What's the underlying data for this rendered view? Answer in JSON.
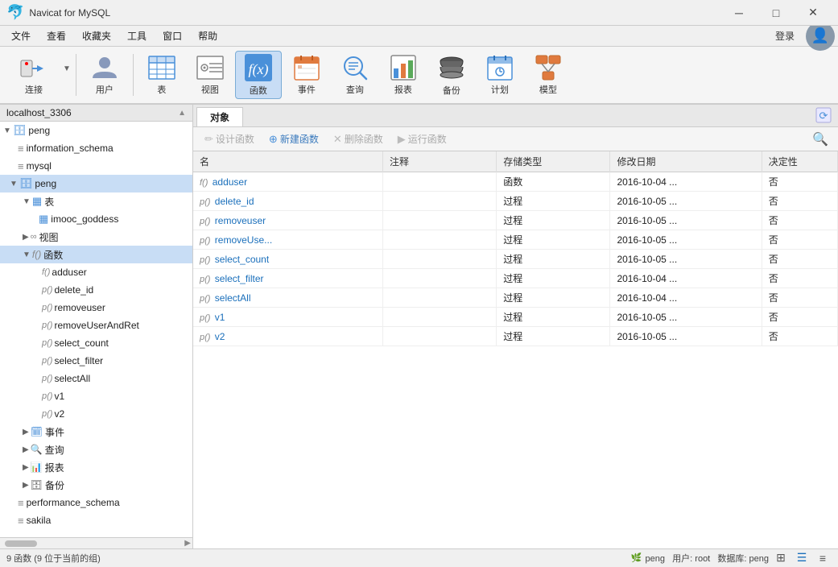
{
  "app": {
    "title": "Navicat for MySQL",
    "logo": "🐬"
  },
  "titlebar": {
    "title": "Navicat for MySQL",
    "minimize": "─",
    "maximize": "□",
    "close": "✕"
  },
  "menubar": {
    "items": [
      "文件",
      "查看",
      "收藏夹",
      "工具",
      "窗口",
      "帮助"
    ]
  },
  "toolbar": {
    "buttons": [
      {
        "id": "connect",
        "label": "连接",
        "icon": "🔌"
      },
      {
        "id": "user",
        "label": "用户",
        "icon": "👤"
      },
      {
        "id": "table",
        "label": "表",
        "icon": "📋"
      },
      {
        "id": "view",
        "label": "视图",
        "icon": "👁"
      },
      {
        "id": "function",
        "label": "函数",
        "icon": "ƒ(x)",
        "active": true
      },
      {
        "id": "event",
        "label": "事件",
        "icon": "📅"
      },
      {
        "id": "query",
        "label": "查询",
        "icon": "🔍"
      },
      {
        "id": "report",
        "label": "报表",
        "icon": "📊"
      },
      {
        "id": "backup",
        "label": "备份",
        "icon": "💾"
      },
      {
        "id": "schedule",
        "label": "计划",
        "icon": "🗓"
      },
      {
        "id": "model",
        "label": "模型",
        "icon": "🧩"
      }
    ],
    "login_label": "登录"
  },
  "sidebar": {
    "connection": "localhost_3306",
    "items": [
      {
        "id": "peng-root",
        "label": "peng",
        "level": 0,
        "expanded": true,
        "type": "db"
      },
      {
        "id": "information_schema",
        "label": "information_schema",
        "level": 1,
        "type": "db-item"
      },
      {
        "id": "mysql",
        "label": "mysql",
        "level": 1,
        "type": "db-item"
      },
      {
        "id": "peng-db",
        "label": "peng",
        "level": 1,
        "expanded": true,
        "type": "db-selected"
      },
      {
        "id": "table-group",
        "label": "表",
        "level": 2,
        "expanded": true,
        "type": "group"
      },
      {
        "id": "imooc_goddess",
        "label": "imooc_goddess",
        "level": 3,
        "type": "table"
      },
      {
        "id": "view-group",
        "label": "视图",
        "level": 2,
        "expanded": false,
        "type": "group"
      },
      {
        "id": "func-group",
        "label": "函数",
        "level": 2,
        "expanded": true,
        "type": "group-selected"
      },
      {
        "id": "adduser",
        "label": "adduser",
        "level": 3,
        "type": "func-f0"
      },
      {
        "id": "delete_id",
        "label": "delete_id",
        "level": 3,
        "type": "func-p0"
      },
      {
        "id": "removeuser",
        "label": "removeuser",
        "level": 3,
        "type": "func-p0"
      },
      {
        "id": "removeUserAndRet",
        "label": "removeUserAndRet",
        "level": 3,
        "type": "func-p0"
      },
      {
        "id": "select_count",
        "label": "select_count",
        "level": 3,
        "type": "func-p0"
      },
      {
        "id": "select_filter",
        "label": "select_filter",
        "level": 3,
        "type": "func-p0"
      },
      {
        "id": "selectAll",
        "label": "selectAll",
        "level": 3,
        "type": "func-p0"
      },
      {
        "id": "v1",
        "label": "v1",
        "level": 3,
        "type": "func-p0"
      },
      {
        "id": "v2",
        "label": "v2",
        "level": 3,
        "type": "func-p0"
      },
      {
        "id": "event-group",
        "label": "事件",
        "level": 2,
        "expanded": false,
        "type": "group"
      },
      {
        "id": "query-group",
        "label": "查询",
        "level": 2,
        "expanded": false,
        "type": "group"
      },
      {
        "id": "report-group",
        "label": "报表",
        "level": 2,
        "expanded": false,
        "type": "group"
      },
      {
        "id": "backup-group",
        "label": "备份",
        "level": 2,
        "expanded": false,
        "type": "group"
      },
      {
        "id": "performance_schema",
        "label": "performance_schema",
        "level": 1,
        "type": "db-item"
      },
      {
        "id": "sakila",
        "label": "sakila",
        "level": 1,
        "type": "db-item"
      }
    ]
  },
  "content": {
    "tab_label": "对象",
    "func_toolbar": {
      "design": "设计函数",
      "new": "新建函数",
      "delete": "删除函数",
      "run": "运行函数"
    },
    "table_headers": [
      "名",
      "注释",
      "存储类型",
      "修改日期",
      "决定性"
    ],
    "rows": [
      {
        "prefix": "f()",
        "name": "adduser",
        "comment": "",
        "storage": "函数",
        "date": "2016-10-04 ...",
        "det": "否"
      },
      {
        "prefix": "p()",
        "name": "delete_id",
        "comment": "",
        "storage": "过程",
        "date": "2016-10-05 ...",
        "det": "否"
      },
      {
        "prefix": "p()",
        "name": "removeuser",
        "comment": "",
        "storage": "过程",
        "date": "2016-10-05 ...",
        "det": "否"
      },
      {
        "prefix": "p()",
        "name": "removeUse...",
        "comment": "",
        "storage": "过程",
        "date": "2016-10-05 ...",
        "det": "否"
      },
      {
        "prefix": "p()",
        "name": "select_count",
        "comment": "",
        "storage": "过程",
        "date": "2016-10-05 ...",
        "det": "否"
      },
      {
        "prefix": "p()",
        "name": "select_filter",
        "comment": "",
        "storage": "过程",
        "date": "2016-10-04 ...",
        "det": "否"
      },
      {
        "prefix": "p()",
        "name": "selectAll",
        "comment": "",
        "storage": "过程",
        "date": "2016-10-04 ...",
        "det": "否"
      },
      {
        "prefix": "p()",
        "name": "v1",
        "comment": "",
        "storage": "过程",
        "date": "2016-10-05 ...",
        "det": "否"
      },
      {
        "prefix": "p()",
        "name": "v2",
        "comment": "",
        "storage": "过程",
        "date": "2016-10-05 ...",
        "det": "否"
      }
    ]
  },
  "statusbar": {
    "text": "9 函数 (9 位于当前的组)",
    "db_info": "🌿 peng  用户: root  数据库: peng"
  }
}
